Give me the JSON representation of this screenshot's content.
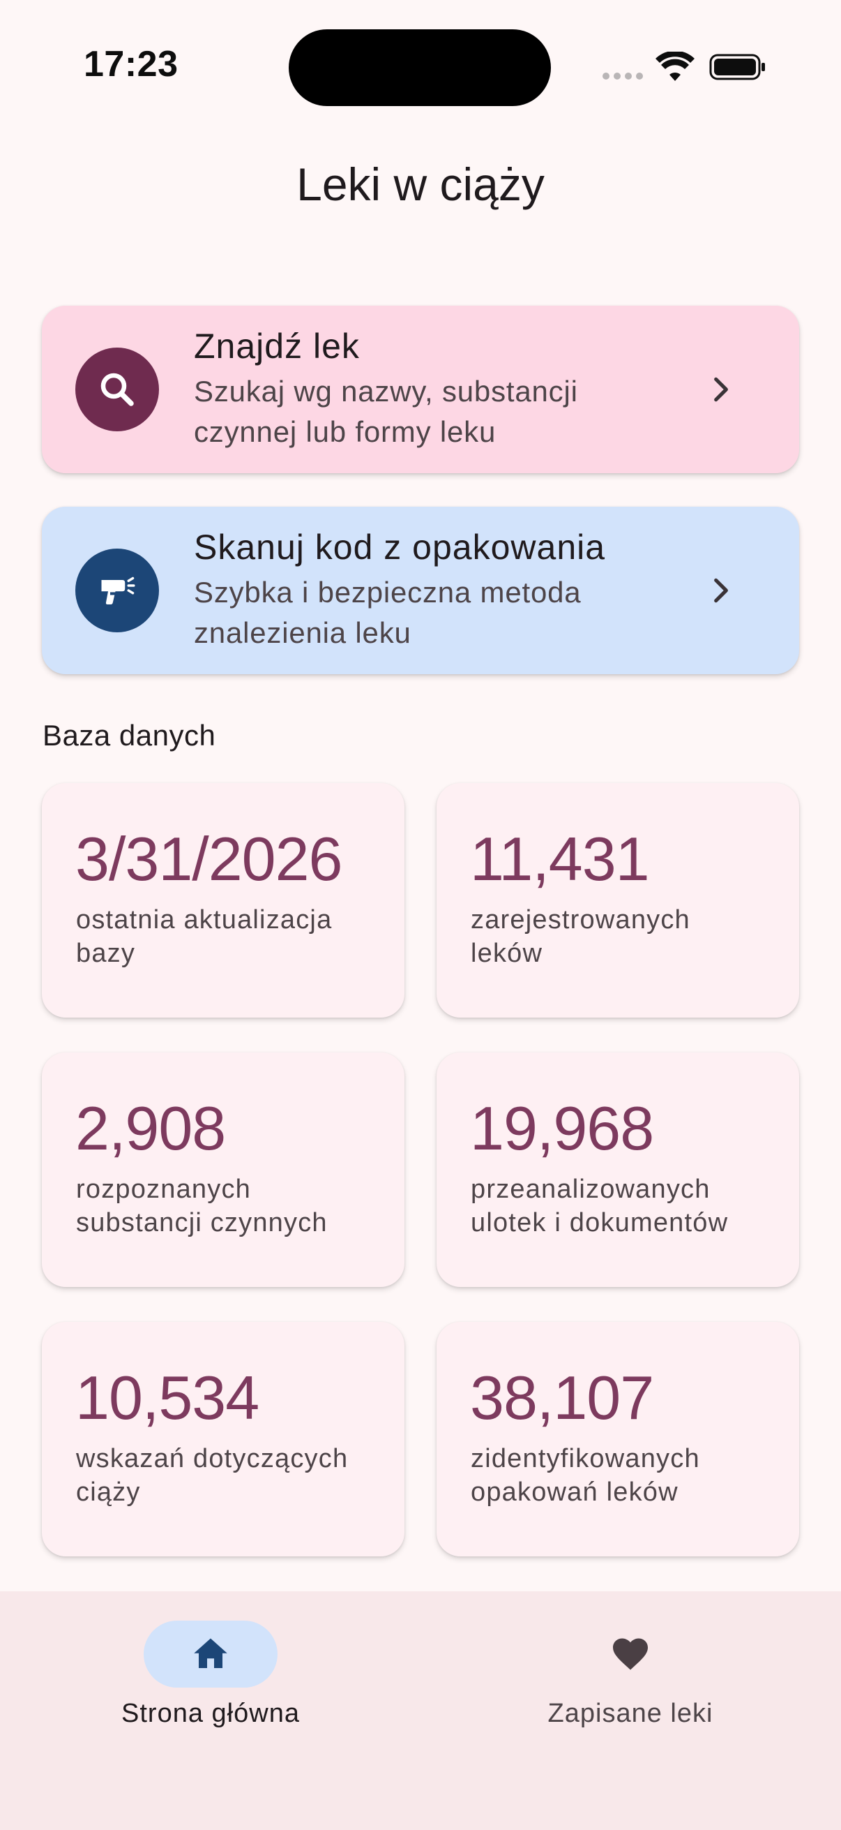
{
  "status_bar": {
    "time": "17:23"
  },
  "header": {
    "title": "Leki w ciąży"
  },
  "actions": [
    {
      "title": "Znajdź lek",
      "subtitle_line1": "Szukaj wg nazwy, substancji",
      "subtitle_line2": "czynnej lub formy leku",
      "icon": "search-icon",
      "background": "#fdd7e4",
      "icon_background": "#6f2b4f"
    },
    {
      "title": "Skanuj kod z opakowania",
      "subtitle_line1": "Szybka i bezpieczna metoda",
      "subtitle_line2": "znalezienia leku",
      "icon": "barcode-scanner-icon",
      "background": "#d2e3fb",
      "icon_background": "#1c4677"
    }
  ],
  "database": {
    "section_label": "Baza danych",
    "stats": [
      {
        "value": "3/31/2026",
        "label_line1": "ostatnia aktualizacja",
        "label_line2": "bazy"
      },
      {
        "value": "11,431",
        "label_line1": "zarejestrowanych",
        "label_line2": "leków"
      },
      {
        "value": "2,908",
        "label_line1": "rozpoznanych",
        "label_line2": "substancji czynnych"
      },
      {
        "value": "19,968",
        "label_line1": "przeanalizowanych",
        "label_line2": "ulotek i dokumentów"
      },
      {
        "value": "10,534",
        "label_line1": "wskazań dotyczących",
        "label_line2": "ciąży"
      },
      {
        "value": "38,107",
        "label_line1": "zidentyfikowanych",
        "label_line2": "opakowań leków"
      }
    ],
    "value_color": "#7d3a5e"
  },
  "bottom_nav": {
    "items": [
      {
        "label": "Strona główna",
        "icon": "home-icon",
        "selected": true
      },
      {
        "label": "Zapisane leki",
        "icon": "heart-icon",
        "selected": false
      }
    ]
  }
}
